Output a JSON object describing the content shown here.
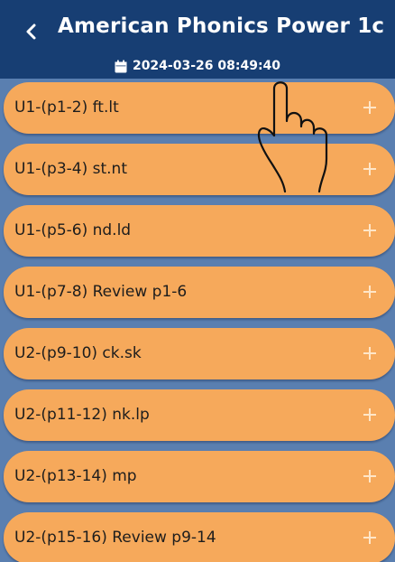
{
  "header": {
    "title": "American Phonics Power 1c",
    "datetime": "2024-03-26 08:49:40",
    "back_icon": "chevron-left-icon",
    "date_icon": "calendar-icon"
  },
  "list": {
    "items": [
      {
        "label": "U1-(p1-2) ft.lt"
      },
      {
        "label": "U1-(p3-4) st.nt"
      },
      {
        "label": "U1-(p5-6) nd.ld"
      },
      {
        "label": "U1-(p7-8) Review p1-6"
      },
      {
        "label": "U2-(p9-10) ck.sk"
      },
      {
        "label": "U2-(p11-12) nk.lp"
      },
      {
        "label": "U2-(p13-14) mp"
      },
      {
        "label": "U2-(p15-16) Review p9-14"
      }
    ],
    "item_icon": "plus-icon"
  },
  "colors": {
    "header_bg": "#173e73",
    "page_bg": "#5a7fb0",
    "item_bg": "#f6a95b",
    "item_text": "#1d1d1d",
    "plus": "#ffe6c8"
  }
}
